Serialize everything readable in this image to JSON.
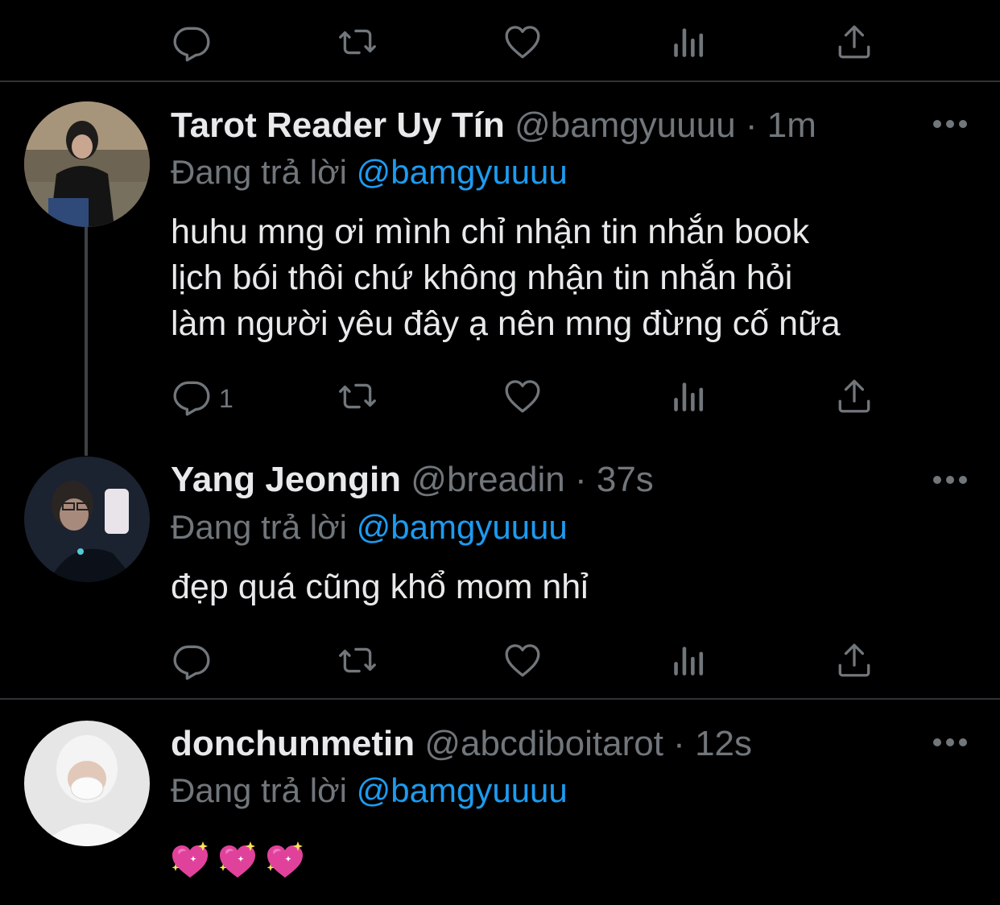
{
  "top_actions": {
    "reply_icon": "reply-icon",
    "retweet_icon": "retweet-icon",
    "like_icon": "like-icon",
    "views_icon": "views-icon",
    "share_icon": "share-icon"
  },
  "tweets": [
    {
      "name": "Tarot Reader Uy Tín",
      "handle": "@bamgyuuuu",
      "sep": " · ",
      "time": "1m",
      "reply_prefix": "Đang trả lời ",
      "reply_to": "@bamgyuuuu",
      "lines": [
        "huhu mng ơi mình chỉ nhận tin nhắn book",
        "lịch bói thôi chứ không nhận tin nhắn hỏi",
        "làm người yêu đây ạ nên mng đừng cố nữa"
      ],
      "reply_count": "1"
    },
    {
      "name": "Yang Jeongin",
      "handle": "@breadin",
      "sep": " · ",
      "time": "37s",
      "reply_prefix": "Đang trả lời ",
      "reply_to": "@bamgyuuuu",
      "lines": [
        "đẹp quá cũng khổ mom nhỉ"
      ]
    },
    {
      "name": "donchunmetin",
      "handle": "@abcdiboitarot",
      "sep": " · ",
      "time": "12s",
      "reply_prefix": "Đang trả lời ",
      "reply_to": "@bamgyuuuu",
      "emoji": [
        "sparkling-heart",
        "sparkling-heart",
        "sparkling-heart"
      ]
    }
  ],
  "colors": {
    "background": "#000000",
    "mention": "#1d9bf0",
    "muted": "#71767b",
    "divider": "#2f3336",
    "heart_emoji": "#e0429b"
  }
}
